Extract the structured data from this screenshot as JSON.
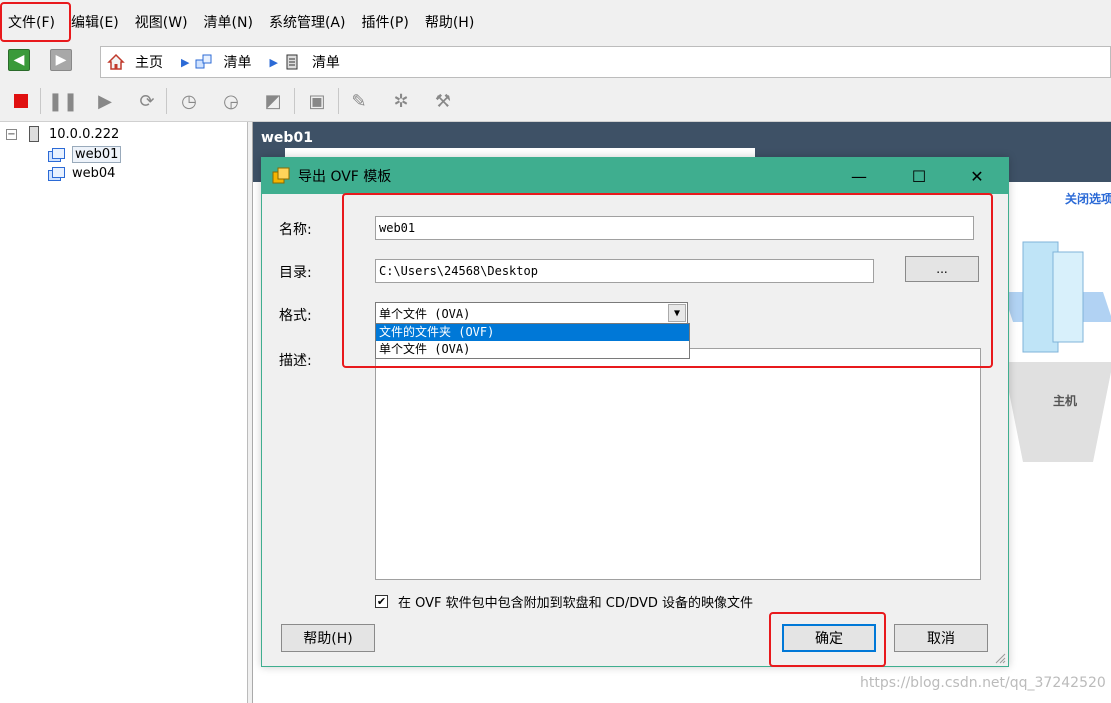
{
  "menubar": {
    "items": [
      "文件(F)",
      "编辑(E)",
      "视图(W)",
      "清单(N)",
      "系统管理(A)",
      "插件(P)",
      "帮助(H)"
    ]
  },
  "navbar": {
    "breadcrumbs": [
      "主页",
      "清单",
      "清单"
    ]
  },
  "tree": {
    "host": "10.0.0.222",
    "vms": [
      "web01",
      "web04"
    ]
  },
  "right_panel": {
    "title": "web01",
    "close_tab_link": "关闭选项",
    "host_label": "主机"
  },
  "dialog": {
    "title": "导出 OVF 模板",
    "name_label": "名称:",
    "name_value": "web01",
    "dir_label": "目录:",
    "dir_value": "C:\\Users\\24568\\Desktop",
    "browse_label": "...",
    "format_label": "格式:",
    "format_selected": "单个文件 (OVA)",
    "format_options": [
      "文件的文件夹 (OVF)",
      "单个文件 (OVA)"
    ],
    "desc_label": "描述:",
    "checkbox_label": "在 OVF 软件包中包含附加到软盘和 CD/DVD 设备的映像文件",
    "checkbox_mark": "✔",
    "help_button": "帮助(H)",
    "ok_button": "确定",
    "cancel_button": "取消",
    "win_minimize": "—",
    "win_maximize": "☐",
    "win_close": "✕"
  },
  "watermark": "https://blog.csdn.net/qq_37242520",
  "colors": {
    "dialog_accent": "#3fae8f",
    "header_bg": "#3e5166",
    "selection": "#0078d7",
    "annotation": "#e8191c"
  }
}
